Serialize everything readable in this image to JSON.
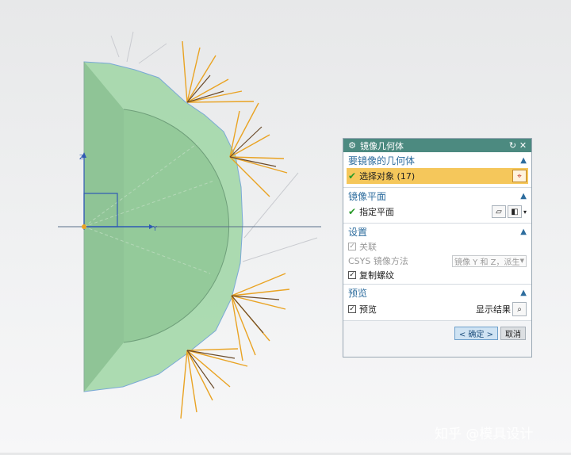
{
  "dialog": {
    "title": "镜像几何体",
    "sections": {
      "geometry": {
        "title": "要镜像的几何体",
        "select_label": "选择对象 (17)"
      },
      "plane": {
        "title": "镜像平面",
        "specify_label": "指定平面"
      },
      "settings": {
        "title": "设置",
        "associative_label": "关联",
        "csys_label": "CSYS 镜像方法",
        "csys_value": "镜像 Y 和 Z，派生",
        "copy_threads_label": "复制螺纹"
      },
      "preview": {
        "title": "预览",
        "preview_label": "预览",
        "show_result_label": "显示结果"
      }
    },
    "buttons": {
      "ok": "< 确定 >",
      "cancel": "取消"
    }
  },
  "viewport": {
    "axis_x_label": "Y",
    "axis_y_label": "Z"
  },
  "watermark": "知乎 @模具设计"
}
